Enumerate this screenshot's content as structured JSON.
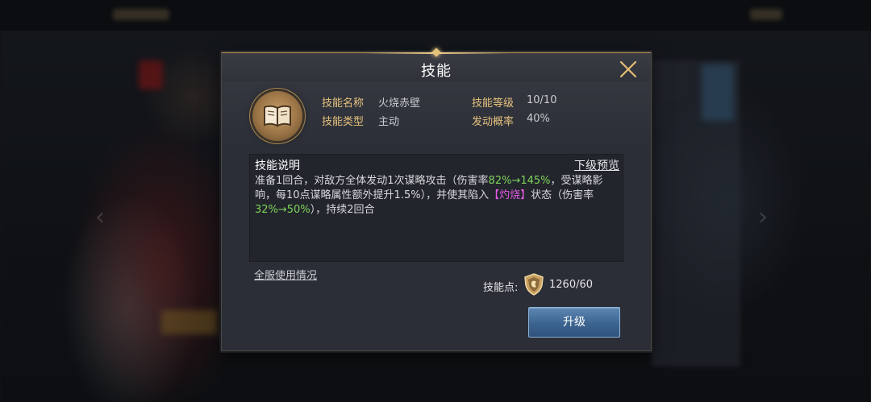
{
  "dialog": {
    "title": "技能",
    "close_icon": "close-icon"
  },
  "skill": {
    "icon": "book-icon",
    "name_label": "技能名称",
    "name_value": "火烧赤壁",
    "type_label": "技能类型",
    "type_value": "主动",
    "level_label": "技能等级",
    "level_value": "10/10",
    "chance_label": "发动概率",
    "chance_value": "40%"
  },
  "description": {
    "title": "技能说明",
    "preview_link": "下级预览",
    "text_1": "准备1回合，对敌方全体发动1次谋略攻击（伤害率",
    "text_2": "82%→145%",
    "text_3": "，受谋略影响，每10点谋略属性额外提升1.5%），并使其陷入",
    "text_4": "【灼烧】",
    "text_5": "状态（伤害率",
    "text_6": "32%→50%",
    "text_7": "），持续2回合"
  },
  "footer": {
    "server_usage_link": "全服使用情况",
    "points_label": "技能点:",
    "points_icon": "shield-coin-icon",
    "points_value": "1260/60",
    "upgrade_button": "升级"
  },
  "colors": {
    "accent_gold": "#e6c27e",
    "highlight_green": "#7fd45a",
    "highlight_pink": "#e35ae4",
    "button_blue": "#3c6490"
  }
}
